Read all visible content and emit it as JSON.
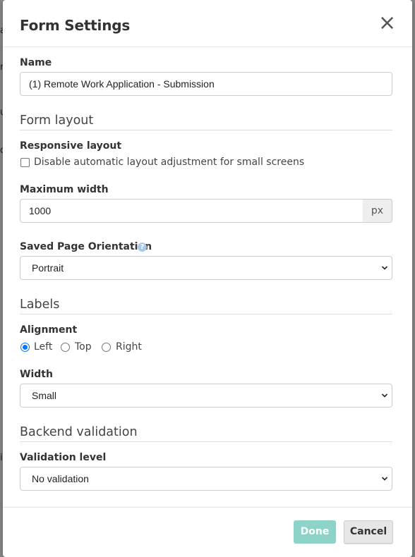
{
  "backdrop": {
    "fragments": [
      "a",
      "r",
      "u",
      "o",
      "i"
    ]
  },
  "modal": {
    "title": "Form Settings",
    "close_icon": "×"
  },
  "name_field": {
    "label": "Name",
    "value": "(1) Remote Work Application - Submission"
  },
  "form_layout": {
    "section_title": "Form layout",
    "responsive_label": "Responsive layout",
    "responsive_checkbox_label": "Disable automatic layout adjustment for small screens",
    "responsive_checked": false,
    "max_width_label": "Maximum width",
    "max_width_value": "1000",
    "max_width_unit": "px",
    "orientation_label": "Saved Page Orientation",
    "orientation_help_icon": "?",
    "orientation_value": "Portrait"
  },
  "labels": {
    "section_title": "Labels",
    "alignment_label": "Alignment",
    "alignment_options": [
      "Left",
      "Top",
      "Right"
    ],
    "alignment_selected": "Left",
    "width_label": "Width",
    "width_value": "Small"
  },
  "backend_validation": {
    "section_title": "Backend validation",
    "level_label": "Validation level",
    "level_value": "No validation"
  },
  "footer": {
    "done_label": "Done",
    "cancel_label": "Cancel"
  },
  "colors": {
    "done_button": "#8dd3c7",
    "radio_accent": "#0075ff",
    "help_icon": "#a9c9e6"
  }
}
